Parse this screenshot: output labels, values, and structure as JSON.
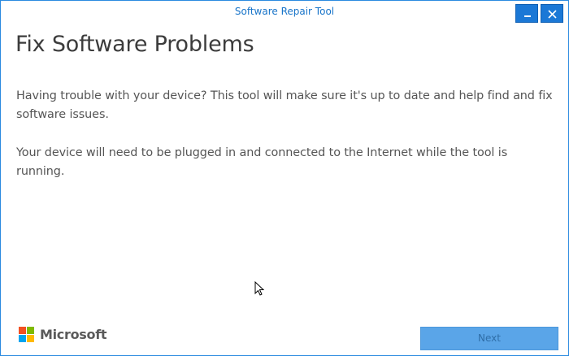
{
  "window": {
    "title": "Software Repair Tool",
    "accent_color": "#1b78d6",
    "buttons": {
      "minimize_icon": "minimize-icon",
      "close_icon": "close-icon"
    }
  },
  "main": {
    "heading": "Fix Software Problems",
    "paragraphs": [
      "Having trouble with your device? This tool will make sure it's up to date and help find and fix software issues.",
      "Your device will need to be plugged in and connected to the Internet while the tool is running."
    ]
  },
  "footer": {
    "brand_name": "Microsoft",
    "logo_colors": [
      "#f25022",
      "#7fba00",
      "#00a4ef",
      "#ffb900"
    ],
    "next_label": "Next",
    "next_enabled": false
  },
  "cursor_icon": "mouse-pointer-icon"
}
